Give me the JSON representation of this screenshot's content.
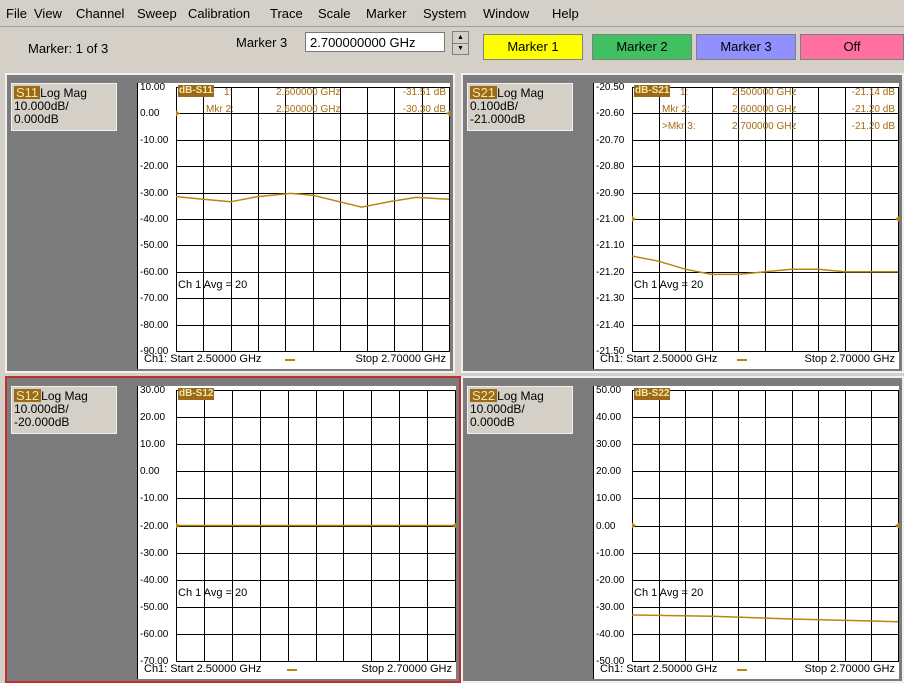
{
  "menu": [
    "File",
    "View",
    "Channel",
    "Sweep",
    "Calibration",
    "Trace",
    "Scale",
    "Marker",
    "System",
    "Window",
    "Help"
  ],
  "toolbar": {
    "marker_count": "Marker: 1 of 3",
    "marker3_label": "Marker 3",
    "freq_value": "2.700000000 GHz",
    "buttons": [
      {
        "label": "Marker 1",
        "color": "#ffff00"
      },
      {
        "label": "Marker 2",
        "color": "#40c060"
      },
      {
        "label": "Marker 3",
        "color": "#9090ff"
      },
      {
        "label": "Off",
        "color": "#ff6fa0"
      }
    ]
  },
  "colors": {
    "trace": "#b8860b",
    "marker_text": "#a46c12"
  },
  "panels": [
    {
      "id": "s11",
      "param": "S11",
      "format": "Log Mag",
      "scale": "10.000dB/",
      "ref": "0.000dB",
      "trace_tag": "dB-S11",
      "ylabels": [
        "10.00",
        "0.00",
        "-10.00",
        "-20.00",
        "-30.00",
        "-40.00",
        "-50.00",
        "-60.00",
        "-70.00",
        "-80.00",
        "-90.00"
      ],
      "markers": [
        {
          "name": "1:",
          "freq": "2.500000 GHz",
          "val": "-31.51 dB"
        },
        {
          "name": "Mkr 2:",
          "freq": "2.600000 GHz",
          "val": "-30.30 dB"
        }
      ],
      "avg": "Ch 1 Avg = 20",
      "start": "Ch1: Start 2.50000 GHz",
      "stop": "Stop 2.70000 GHz",
      "selected": false
    },
    {
      "id": "s21",
      "param": "S21",
      "format": "Log Mag",
      "scale": "0.100dB/",
      "ref": "-21.000dB",
      "trace_tag": "dB-S21",
      "ylabels": [
        "-20.50",
        "-20.60",
        "-20.70",
        "-20.80",
        "-20.90",
        "-21.00",
        "-21.10",
        "-21.20",
        "-21.30",
        "-21.40",
        "-21.50"
      ],
      "markers": [
        {
          "name": "1:",
          "freq": "2.500000 GHz",
          "val": "-21.14 dB"
        },
        {
          "name": "Mkr 2:",
          "freq": "2.600000 GHz",
          "val": "-21.20 dB"
        },
        {
          "name": ">Mkr 3:",
          "freq": "2.700000 GHz",
          "val": "-21.20 dB"
        }
      ],
      "avg": "Ch 1 Avg = 20",
      "start": "Ch1: Start 2.50000 GHz",
      "stop": "Stop 2.70000 GHz",
      "selected": false
    },
    {
      "id": "s12",
      "param": "S12",
      "format": "Log Mag",
      "scale": "10.000dB/",
      "ref": "-20.000dB",
      "trace_tag": "dB-S12",
      "ylabels": [
        "30.00",
        "20.00",
        "10.00",
        "0.00",
        "-10.00",
        "-20.00",
        "-30.00",
        "-40.00",
        "-50.00",
        "-60.00",
        "-70.00"
      ],
      "markers": [],
      "avg": "Ch 1 Avg = 20",
      "start": "Ch1: Start 2.50000 GHz",
      "stop": "Stop 2.70000 GHz",
      "selected": true
    },
    {
      "id": "s22",
      "param": "S22",
      "format": "Log Mag",
      "scale": "10.000dB/",
      "ref": "0.000dB",
      "trace_tag": "dB-S22",
      "ylabels": [
        "50.00",
        "40.00",
        "30.00",
        "20.00",
        "10.00",
        "0.00",
        "-10.00",
        "-20.00",
        "-30.00",
        "-40.00",
        "-50.00"
      ],
      "markers": [],
      "avg": "Ch 1 Avg = 20",
      "start": "Ch1: Start 2.50000 GHz",
      "stop": "Stop 2.70000 GHz",
      "selected": false
    }
  ]
}
